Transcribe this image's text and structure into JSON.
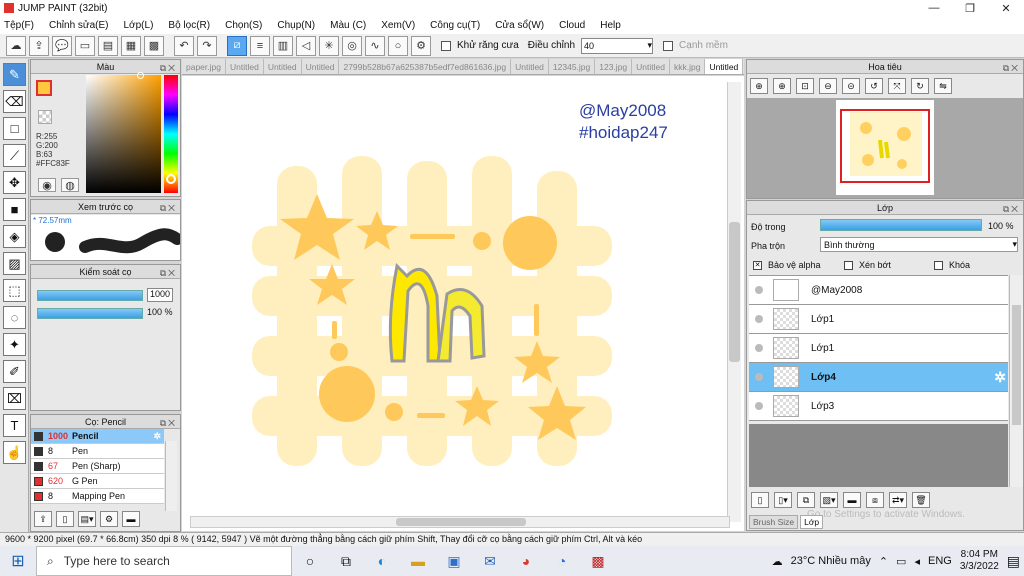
{
  "window": {
    "title": "JUMP PAINT (32bit)",
    "buttons": [
      "—",
      "❐",
      "✕"
    ]
  },
  "menu": [
    "Tệp(F)",
    "Chỉnh sửa(E)",
    "Lớp(L)",
    "Bộ lọc(R)",
    "Chọn(S)",
    "Chụp(N)",
    "Màu (C)",
    "Xem(V)",
    "Công cụ(T)",
    "Cửa sổ(W)",
    "Cloud",
    "Help"
  ],
  "toolbar": {
    "antialias_label": "Khử răng cưa",
    "adjust_label": "Điều chỉnh",
    "adjust_value": "40",
    "snap_label": "Cạnh mềm"
  },
  "color_panel": {
    "title": "Màu",
    "r": "R:255",
    "g": "G:200",
    "b": "B:63",
    "hex": "#FFC83F",
    "primary_color": "#FFC83F"
  },
  "preview_panel": {
    "title": "Xem trước cọ",
    "size": "72.57mm"
  },
  "control_panel": {
    "title": "Kiểm soát cọ",
    "size_value": "1000",
    "opacity_value": "100 %",
    "size_level": 1.0,
    "opacity_level": 1.0
  },
  "brush_panel": {
    "title": "Cọ: Pencil",
    "brushes": [
      {
        "size": "1000",
        "name": "Pencil",
        "color": "#333333"
      },
      {
        "size": "8",
        "name": "Pen",
        "color": "#333333"
      },
      {
        "size": "67",
        "name": "Pen (Sharp)",
        "color": "#333333"
      },
      {
        "size": "620",
        "name": "G Pen",
        "color": "#e03030"
      },
      {
        "size": "8",
        "name": "Mapping Pen",
        "color": "#e03030"
      }
    ]
  },
  "tabs": [
    "paper.jpg",
    "Untitled",
    "Untitled",
    "Untitled",
    "2799b528b67a625387b5edf7ed861636.jpg",
    "Untitled",
    "12345.jpg",
    "123.jpg",
    "Untitled",
    "kkk.jpg",
    "Untitled"
  ],
  "canvas": {
    "text1": "@May2008",
    "text2": "#hoidap247"
  },
  "nav_panel": {
    "title": "Hoa tiêu"
  },
  "layer_panel": {
    "title": "Lớp",
    "opacity_label": "Độ trong",
    "opacity_value": "100 %",
    "opacity_level": 1.0,
    "blend_label": "Pha trộn",
    "blend_value": "Bình thường",
    "protect_alpha": "Bảo vệ alpha",
    "clip": "Xén bớt",
    "lock": "Khóa",
    "layers": [
      {
        "name": "@May2008"
      },
      {
        "name": "Lớp1"
      },
      {
        "name": "Lớp1"
      },
      {
        "name": "Lớp4"
      },
      {
        "name": "Lớp3"
      }
    ],
    "tab_brush_size": "Brush Size",
    "tab_layer": "Lớp",
    "watermark": "Go to Settings to activate Windows."
  },
  "status": {
    "text": "9600 * 9200 pixel  (69.7 * 66.8cm)  350 dpi   8 %  ( 9142, 5947 )  Vẽ một đường thẳng bằng cách giữ phím Shift, Thay đổi cỡ cọ bằng cách giữ phím Ctrl, Alt và kéo"
  },
  "taskbar": {
    "search_placeholder": "Type here to search",
    "weather": "23°C  Nhiều mây",
    "lang": "ENG",
    "time": "8:04 PM",
    "date": "3/3/2022"
  }
}
